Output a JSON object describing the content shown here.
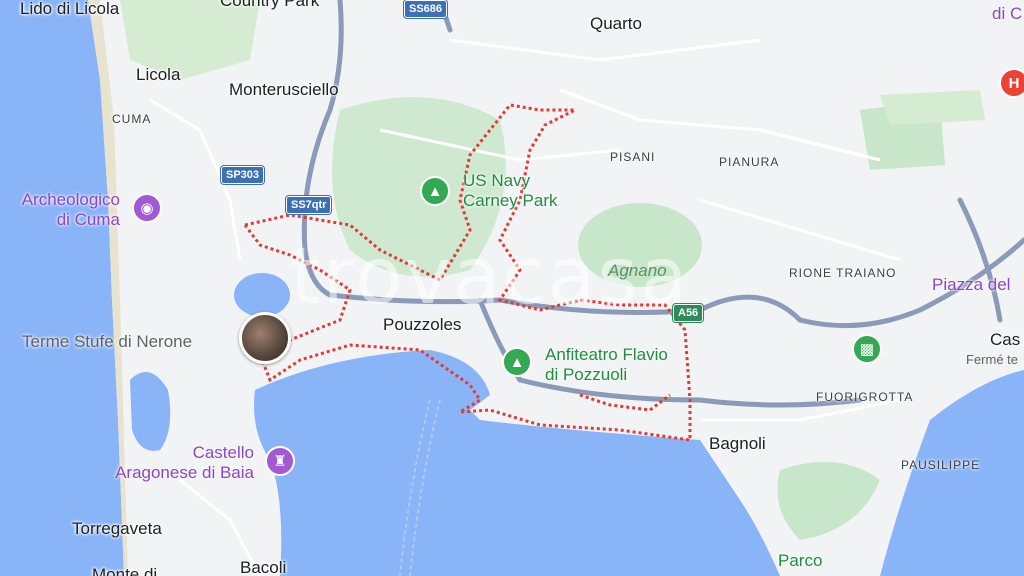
{
  "map": {
    "watermark": "trovacasa",
    "places": {
      "lido_di_licola": "Lido di Licola",
      "country_park": "Country Park",
      "quarto": "Quarto",
      "licola": "Licola",
      "monterusciello": "Monterusciello",
      "cuma": "CUMA",
      "pisani": "PISANI",
      "pianura": "PIANURA",
      "rione_traiano": "RIONE TRAIANO",
      "piazza_del": "Piazza del",
      "pouzzoles": "Pouzzoles",
      "fuorigrotta": "FUORIGROTTA",
      "bagnoli": "Bagnoli",
      "posillipo": "PAUSILIPPE",
      "torregaveta": "Torregaveta",
      "bacoli": "Bacoli",
      "monte_di": "Monte di",
      "cas": "Cas",
      "ferme": "Fermé te",
      "di_c": "di C",
      "parco": "Parco"
    },
    "natural": {
      "agnano": "Agnano"
    },
    "pois": {
      "archeologico": "Archeologico",
      "di_cuma": "di Cuma",
      "terme": "Terme Stufe di Nerone",
      "castello": "Castello",
      "aragonese": "Aragonese di Baia",
      "us_navy": "US Navy",
      "carney_park": "Carney Park",
      "anfiteatro": "Anfiteatro Flavio",
      "di_pozzuoli": "di Pozzuoli"
    },
    "roads": {
      "ss686": "SS686",
      "sp303": "SP303",
      "ss7qtr": "SS7qtr",
      "a56": "A56"
    },
    "icons": {
      "museum": "camera-icon",
      "park": "tree-icon",
      "castle": "castle-icon",
      "hospital": "H",
      "station": "transit-icon"
    },
    "colors": {
      "water": "#8ab4f8",
      "land": "#f1f3f4",
      "park": "#c8e6c9",
      "highway": "#8a9ab8",
      "boundary": "#e53935"
    }
  }
}
